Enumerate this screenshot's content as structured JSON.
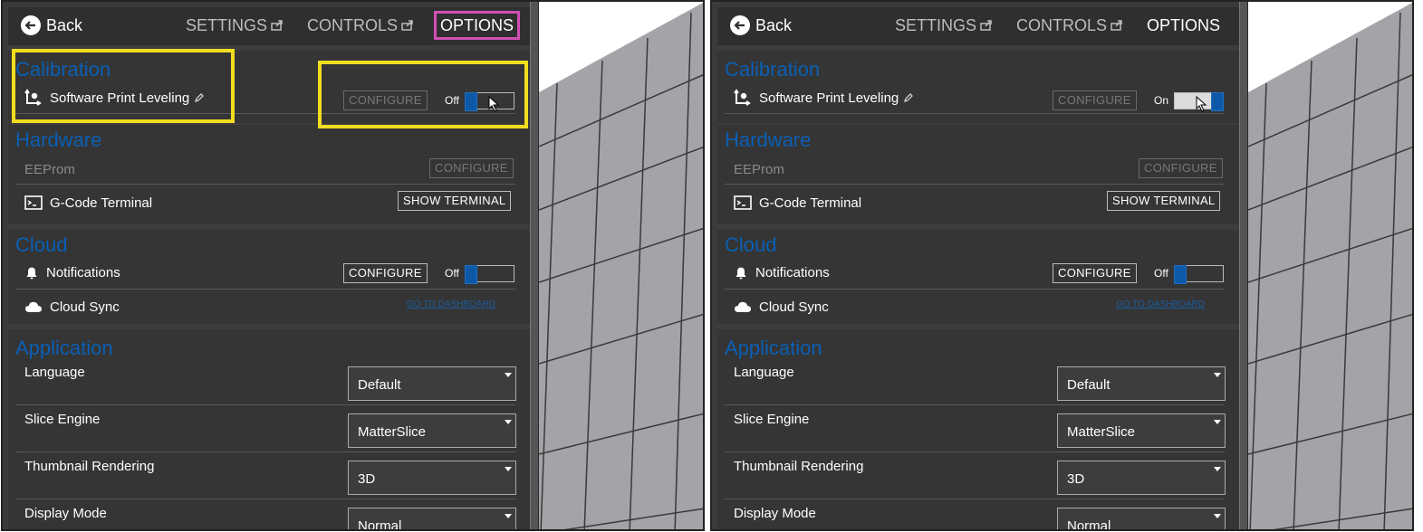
{
  "panels": [
    {
      "id": "left",
      "header": {
        "back_label": "Back",
        "tabs": [
          "SETTINGS",
          "CONTROLS",
          "OPTIONS"
        ]
      },
      "sections": {
        "calibration": {
          "title": "Calibration",
          "rows": [
            {
              "label": "Software Print Leveling",
              "button": "CONFIGURE",
              "toggle_label": "Off",
              "toggle_state": "off"
            }
          ]
        },
        "hardware": {
          "title": "Hardware",
          "rows": [
            {
              "label": "EEProm",
              "button": "CONFIGURE"
            },
            {
              "label": "G-Code Terminal",
              "button": "SHOW TERMINAL"
            }
          ]
        },
        "cloud": {
          "title": "Cloud",
          "rows": [
            {
              "label": "Notifications",
              "button": "CONFIGURE",
              "toggle_label": "Off",
              "toggle_state": "off"
            },
            {
              "label": "Cloud Sync",
              "link": "GO TO DASHBOARD"
            }
          ]
        },
        "application": {
          "title": "Application",
          "rows": [
            {
              "label": "Language",
              "value": "Default"
            },
            {
              "label": "Slice Engine",
              "value": "MatterSlice"
            },
            {
              "label": "Thumbnail Rendering",
              "value": "3D"
            },
            {
              "label": "Display Mode",
              "value": "Normal"
            }
          ]
        }
      }
    },
    {
      "id": "right",
      "header": {
        "back_label": "Back",
        "tabs": [
          "SETTINGS",
          "CONTROLS",
          "OPTIONS"
        ]
      },
      "sections": {
        "calibration": {
          "title": "Calibration",
          "rows": [
            {
              "label": "Software Print Leveling",
              "button": "CONFIGURE",
              "toggle_label": "On",
              "toggle_state": "on"
            }
          ]
        },
        "hardware": {
          "title": "Hardware",
          "rows": [
            {
              "label": "EEProm",
              "button": "CONFIGURE"
            },
            {
              "label": "G-Code Terminal",
              "button": "SHOW TERMINAL"
            }
          ]
        },
        "cloud": {
          "title": "Cloud",
          "rows": [
            {
              "label": "Notifications",
              "button": "CONFIGURE",
              "toggle_label": "Off",
              "toggle_state": "off"
            },
            {
              "label": "Cloud Sync",
              "link": "GO TO DASHBOARD"
            }
          ]
        },
        "application": {
          "title": "Application",
          "rows": [
            {
              "label": "Language",
              "value": "Default"
            },
            {
              "label": "Slice Engine",
              "value": "MatterSlice"
            },
            {
              "label": "Thumbnail Rendering",
              "value": "3D"
            },
            {
              "label": "Display Mode",
              "value": "Normal"
            }
          ]
        }
      }
    }
  ],
  "colors": {
    "section_title": "#0a5fb5",
    "highlight_yellow": "#f1dd1f",
    "highlight_magenta": "#d04fb5",
    "toggle_knob": "#0d59a8"
  },
  "icons": [
    "back-arrow-icon",
    "external-link-icon",
    "leveling-icon",
    "pencil-icon",
    "terminal-icon",
    "bell-icon",
    "cloud-icon",
    "chevron-down-icon",
    "mouse-cursor-icon"
  ]
}
